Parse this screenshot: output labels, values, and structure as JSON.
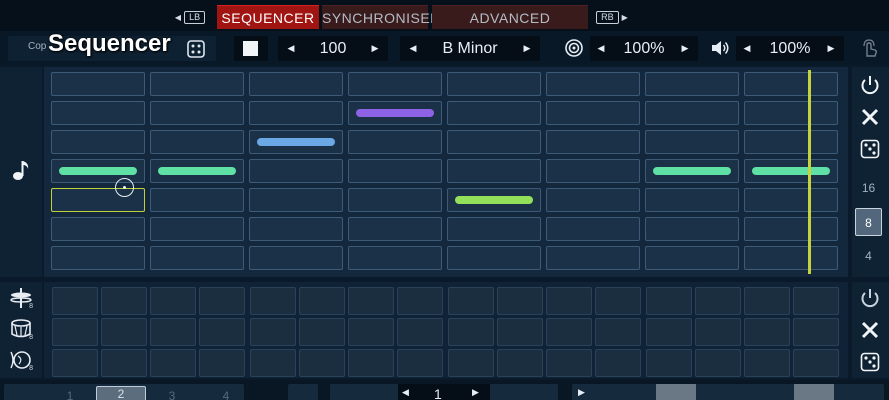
{
  "header": {
    "left_button": "LB",
    "right_button": "RB",
    "tabs": [
      {
        "label": "SEQUENCER",
        "active": true
      },
      {
        "label": "SYNCHRONISER",
        "active": false
      },
      {
        "label": "ADVANCED WAVEFORM",
        "active": false
      }
    ]
  },
  "overlay_title": "Sequencer",
  "toolbar": {
    "copy_label": "Cop",
    "tempo": "100",
    "key": "B Minor",
    "swing": "100%",
    "volume": "100%"
  },
  "length_options": [
    "16",
    "8",
    "4"
  ],
  "selected_length": "8",
  "colors": {
    "accent_red": "#a01412",
    "note_green": "#5fe0a4",
    "note_purple": "#8d62e4",
    "note_blue": "#6aa8e6",
    "note_lime": "#93e05a",
    "playhead": "#c7d33c"
  },
  "notes": [
    {
      "col": 4,
      "row": 1,
      "color": "purple"
    },
    {
      "col": 3,
      "row": 2,
      "color": "blue"
    },
    {
      "col": 1,
      "row": 3,
      "color": "green"
    },
    {
      "col": 2,
      "row": 3,
      "color": "green"
    },
    {
      "col": 7,
      "row": 3,
      "color": "green"
    },
    {
      "col": 8,
      "row": 3,
      "color": "green"
    },
    {
      "col": 5,
      "row": 4,
      "color": "lime"
    }
  ],
  "drum_tracks": [
    {
      "icon": "hihat-icon",
      "sub": "8"
    },
    {
      "icon": "snare-drum-icon",
      "sub": "8"
    },
    {
      "icon": "kick-drum-icon",
      "sub": "8"
    }
  ],
  "bottom": {
    "pages": [
      "1",
      "2",
      "3",
      "4"
    ],
    "active_page": "2",
    "bar_value": "1"
  }
}
